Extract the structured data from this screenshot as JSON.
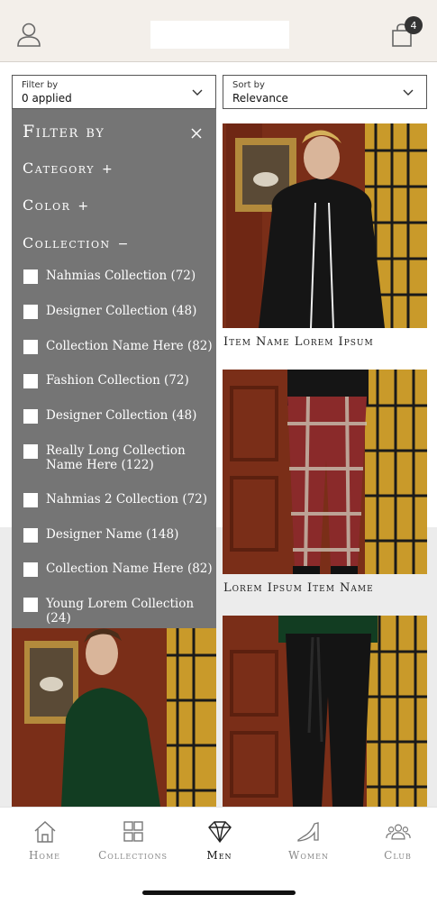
{
  "header": {
    "cart_count": "4",
    "icons": [
      "user-icon",
      "shopping-bag-icon"
    ]
  },
  "filter_dropdown": {
    "label": "Filter by",
    "value": "0 applied"
  },
  "sort_dropdown": {
    "label": "Sort by",
    "value": "Relevance"
  },
  "filter_panel": {
    "title": "Filter by",
    "sections": [
      {
        "label": "Category",
        "state": "+"
      },
      {
        "label": "Color",
        "state": "+"
      },
      {
        "label": "Collection",
        "state": "−"
      }
    ],
    "collections": [
      {
        "label": "Nahmias Collection (72)"
      },
      {
        "label": "Designer Collection (48)"
      },
      {
        "label": "Collection Name Here (82)"
      },
      {
        "label": "Fashion Collection (72)"
      },
      {
        "label": "Designer Collection (48)"
      },
      {
        "label": "Really Long Collection Name Here (122)"
      },
      {
        "label": "Nahmias 2 Collection (72)"
      },
      {
        "label": "Designer Name (148)"
      },
      {
        "label": "Collection Name Here (82)"
      },
      {
        "label": "Young Lorem Collection (24)"
      }
    ]
  },
  "products": [
    {
      "name": "Item Name Lorem Ipsum"
    },
    {
      "name": "Lorem Ipsum Item Name"
    },
    {
      "name": ""
    },
    {
      "name": ""
    }
  ],
  "bottom_nav": {
    "items": [
      {
        "label": "Home",
        "icon": "home-icon"
      },
      {
        "label": "Collections",
        "icon": "grid-icon"
      },
      {
        "label": "Men",
        "icon": "diamond-icon",
        "active": true
      },
      {
        "label": "Women",
        "icon": "heel-icon"
      },
      {
        "label": "Club",
        "icon": "group-icon"
      }
    ]
  },
  "colors": {
    "header_bg": "#f3efea",
    "panel_bg": "#757575",
    "wood": "#7a2e18",
    "plaid_yellow": "#c99a2a"
  }
}
